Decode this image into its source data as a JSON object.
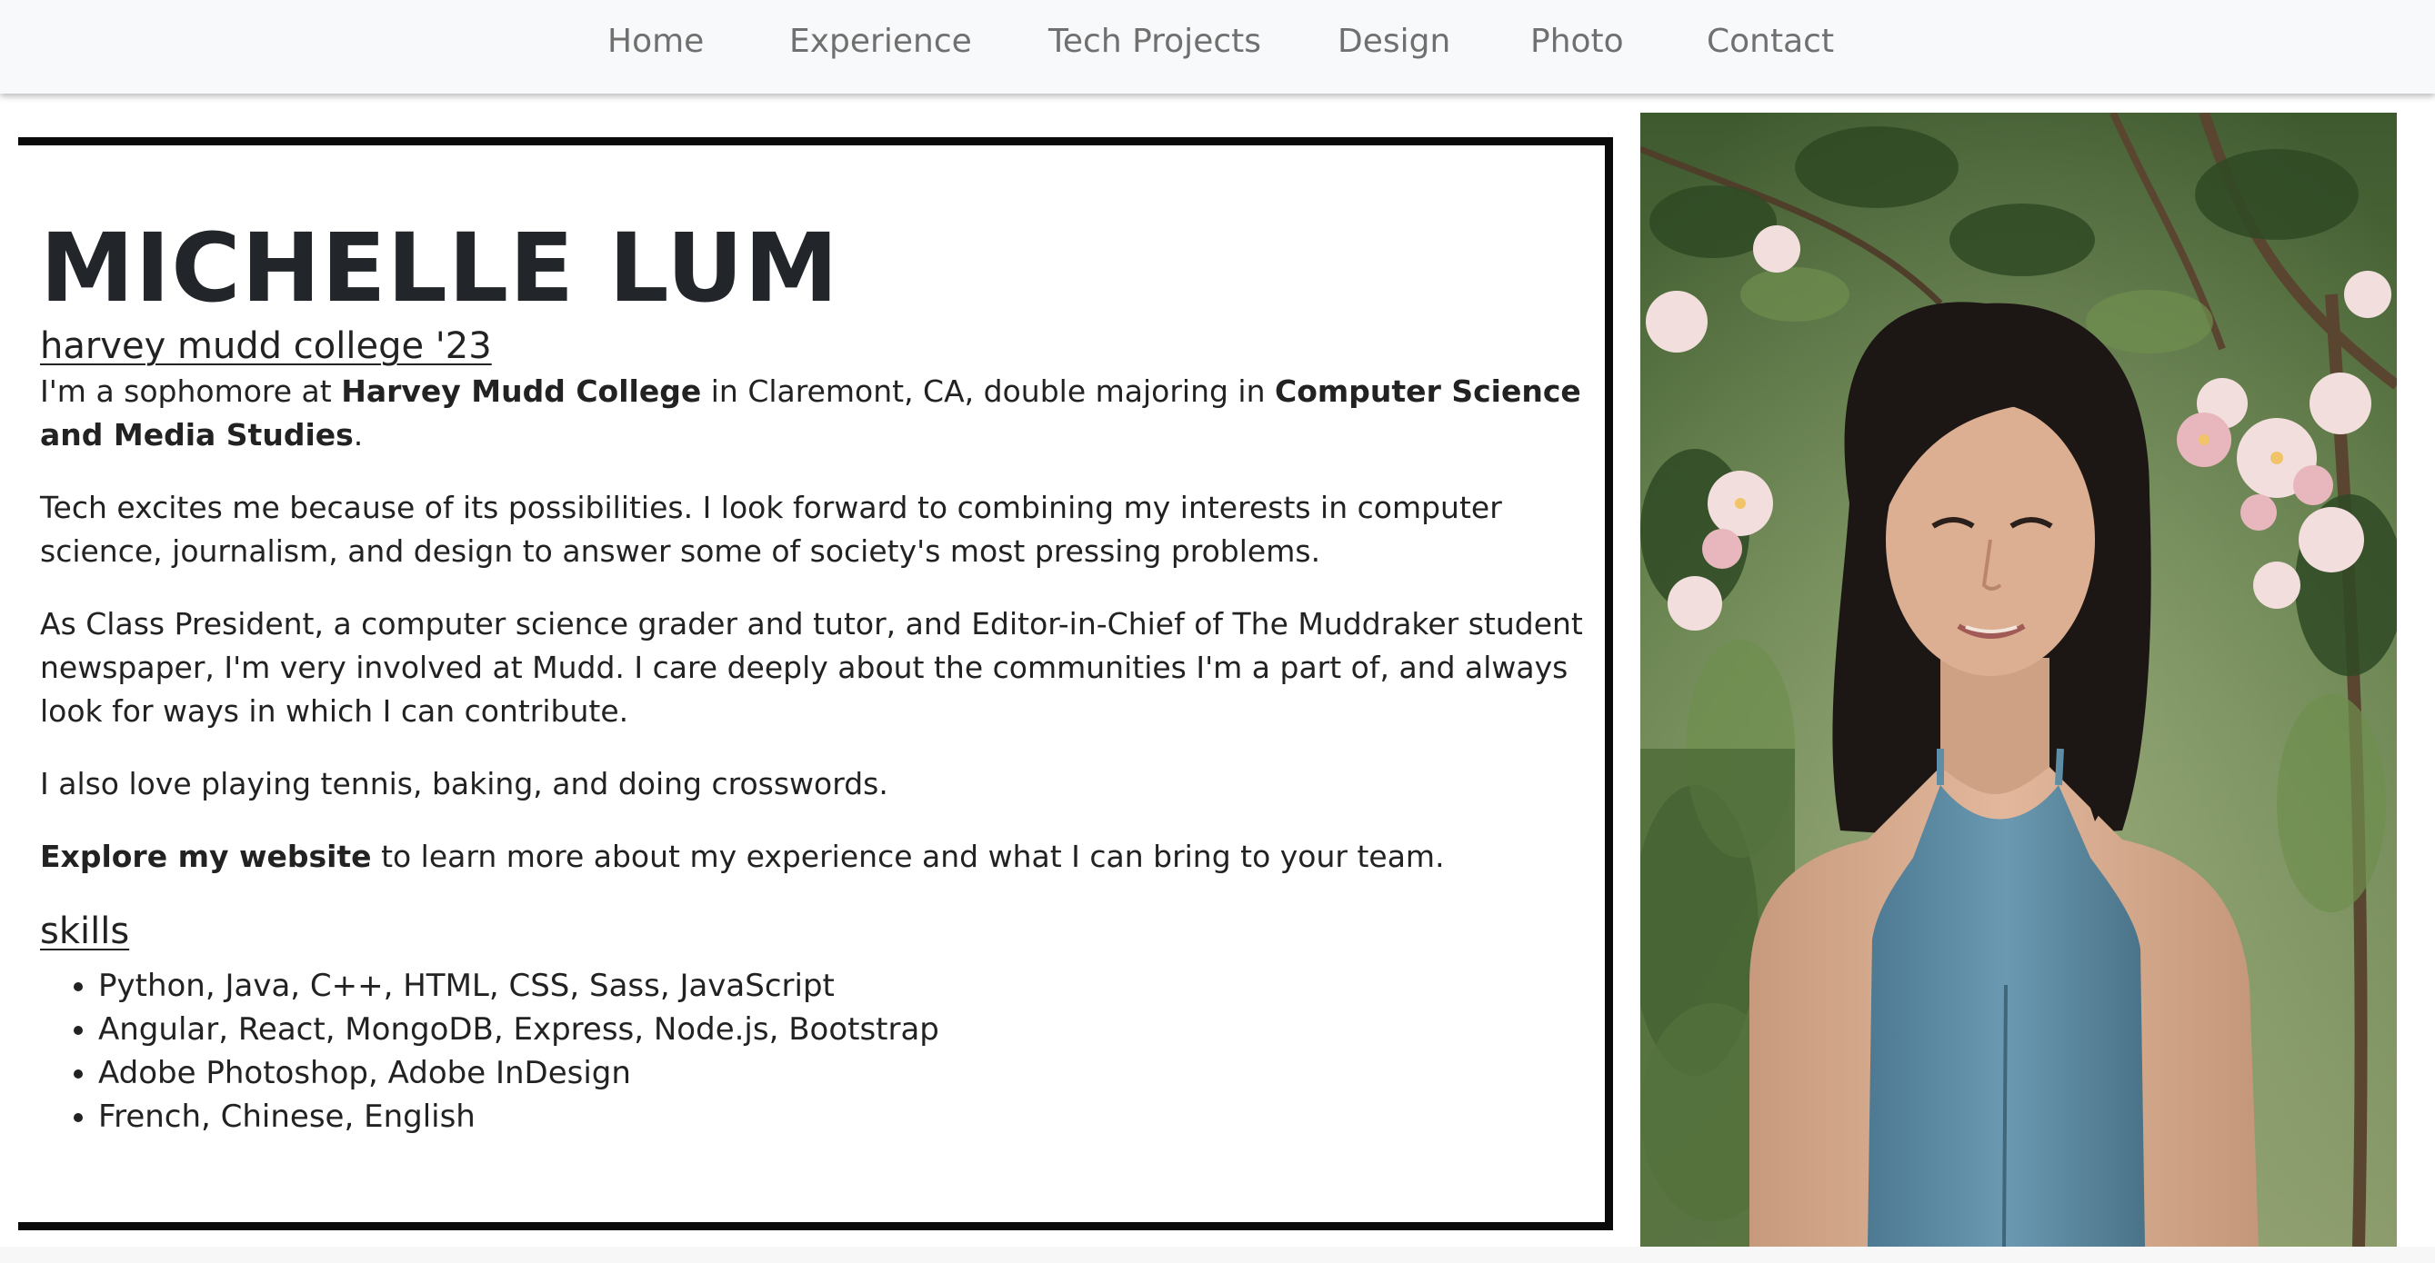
{
  "nav": {
    "items": [
      {
        "label": "Home"
      },
      {
        "label": "Experience"
      },
      {
        "label": "Tech Projects"
      },
      {
        "label": "Design"
      },
      {
        "label": "Photo"
      },
      {
        "label": "Contact"
      }
    ]
  },
  "profile": {
    "name": "MICHELLE LUM",
    "subtitle": "harvey mudd college '23",
    "intro": {
      "pre": "I'm a sophomore at ",
      "college": "Harvey Mudd College",
      "mid": " in Claremont, CA, double majoring in ",
      "majors": "Computer Science and Media Studies",
      "post": "."
    },
    "paragraph_tech": "Tech excites me because of its possibilities. I look forward to combining my interests in computer science, journalism, and design to answer some of society's most pressing problems.",
    "paragraph_involvement": "As Class President, a computer science grader and tutor, and Editor-in-Chief of The Muddraker student newspaper, I'm very involved at Mudd. I care deeply about the communities I'm a part of, and always look for ways in which I can contribute.",
    "paragraph_hobbies": "I also love playing tennis, baking, and doing crosswords.",
    "explore": {
      "bold": "Explore my website",
      "rest": " to learn more about my experience and what I can bring to your team."
    }
  },
  "skills": {
    "heading": "skills",
    "items": [
      "Python, Java, C++, HTML, CSS, Sass, JavaScript",
      "Angular, React, MongoDB, Express, Node.js, Bootstrap",
      "Adobe Photoshop, Adobe InDesign",
      "French, Chinese, English"
    ]
  },
  "colors": {
    "nav_background": "#f8f9fa",
    "nav_text": "#707070",
    "card_border": "#0a0a0a",
    "text": "#222222",
    "dress": "#5f8ea6"
  }
}
